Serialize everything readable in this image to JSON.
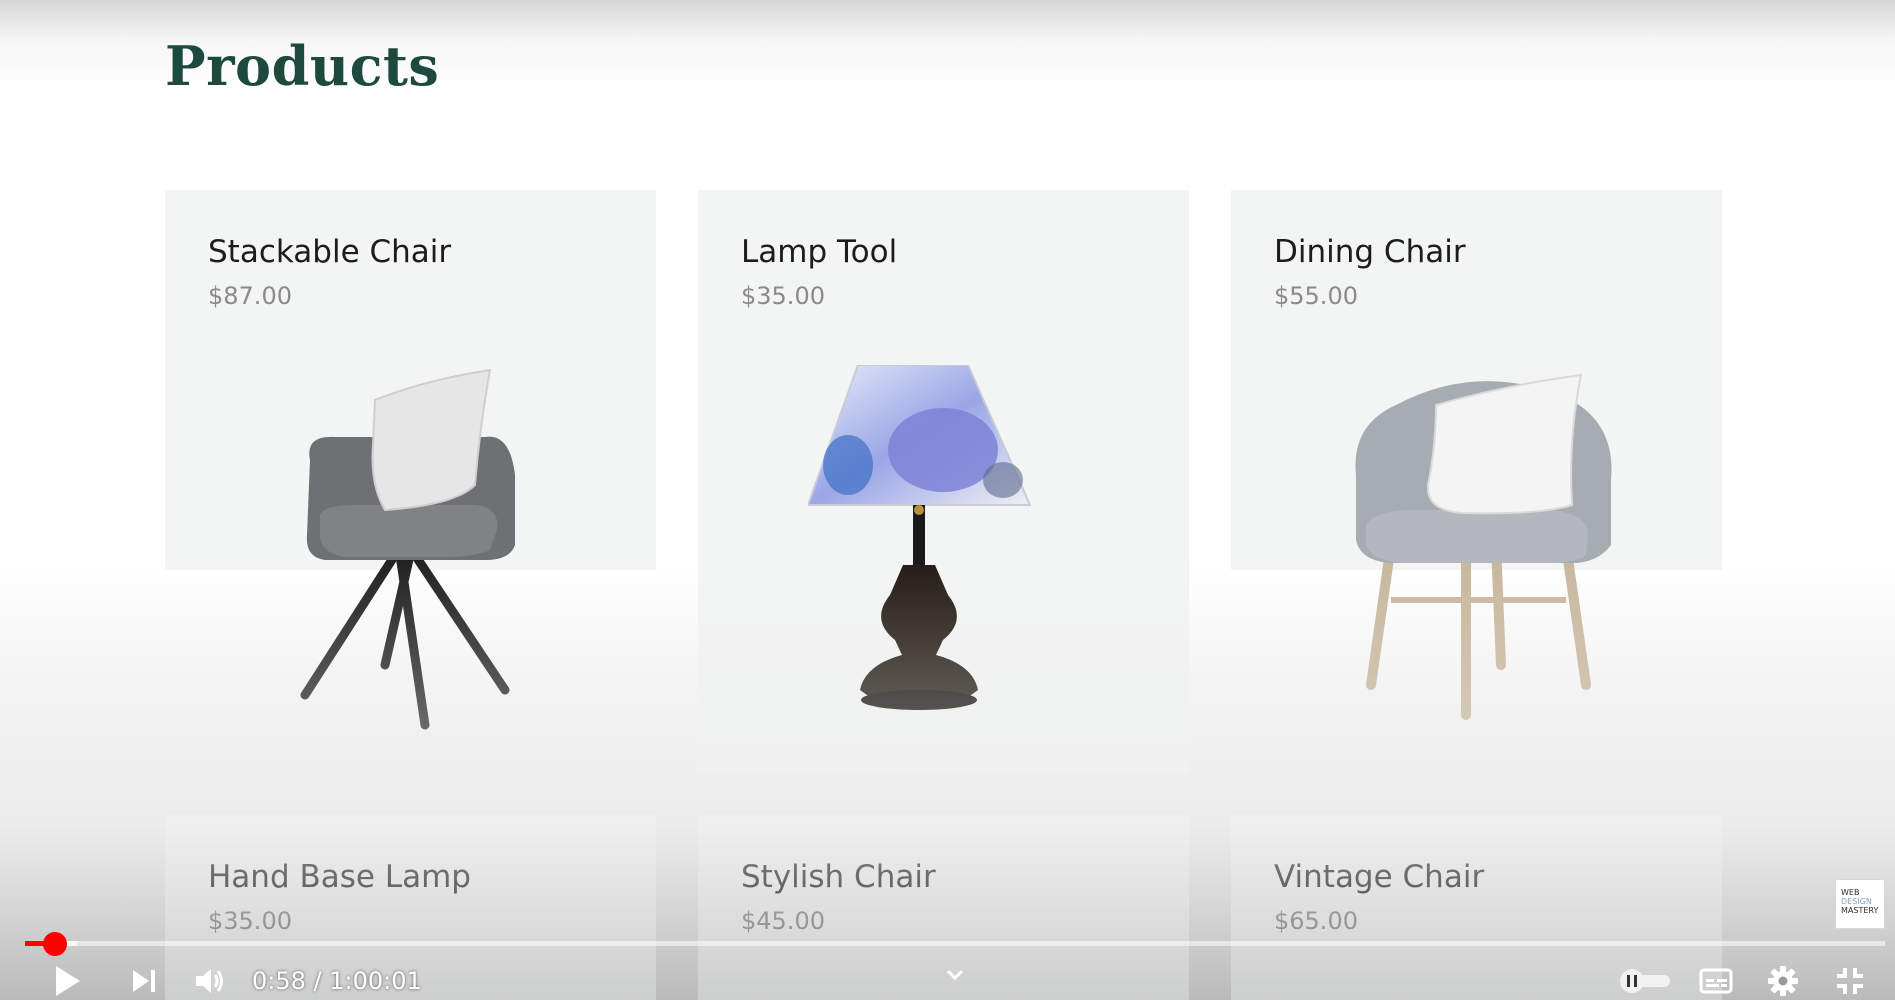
{
  "page": {
    "title": "Products"
  },
  "products": [
    {
      "name": "Stackable Chair",
      "price": "$87.00",
      "icon": "gray-armchair-black-legs"
    },
    {
      "name": "Lamp Tool",
      "price": "$35.00",
      "icon": "floral-table-lamp"
    },
    {
      "name": "Dining Chair",
      "price": "$55.00",
      "icon": "light-gray-armchair-wood-legs"
    },
    {
      "name": "Hand Base Lamp",
      "price": "$35.00"
    },
    {
      "name": "Stylish Chair",
      "price": "$45.00"
    },
    {
      "name": "Vintage Chair",
      "price": "$65.00"
    }
  ],
  "player": {
    "time_display": "0:58 / 1:00:01",
    "progress_fraction": 0.016,
    "buffered_fraction": 0.028,
    "autoplay": "off",
    "icons": [
      "play-icon",
      "next-icon",
      "volume-icon",
      "chevron-down-icon",
      "autoplay-toggle-icon",
      "subtitles-icon",
      "settings-icon",
      "exit-fullscreen-icon"
    ]
  },
  "watermark": {
    "lines": [
      "WEB",
      "DESIGN",
      "MASTERY"
    ]
  },
  "colors": {
    "title": "#1e4a3e",
    "card_bg": "#f3f4f4",
    "progress": "#ff0000"
  }
}
